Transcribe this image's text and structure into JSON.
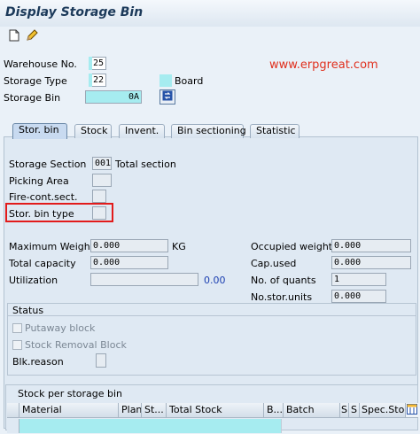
{
  "window": {
    "title": "Display Storage Bin"
  },
  "toolbar": {
    "buttons": [
      {
        "icon": "new-document-icon"
      },
      {
        "icon": "pencil-icon"
      }
    ]
  },
  "watermark": "www.erpgreat.com",
  "header": {
    "warehouse_label": "Warehouse No.",
    "warehouse_value": "25",
    "storage_type_label": "Storage Type",
    "storage_type_value": "22",
    "storage_type_desc": "Board",
    "storage_bin_label": "Storage Bin",
    "storage_bin_value": "0A"
  },
  "tabs": [
    {
      "label": "Stor. bin",
      "active": true
    },
    {
      "label": "Stock",
      "active": false
    },
    {
      "label": "Invent.",
      "active": false
    },
    {
      "label": "Bin sectioning",
      "active": false
    },
    {
      "label": "Statistic",
      "active": false
    }
  ],
  "stor_bin": {
    "storage_section_label": "Storage Section",
    "storage_section_value": "001",
    "storage_section_desc": "Total section",
    "picking_area_label": "Picking Area",
    "fire_cont_label": "Fire-cont.sect.",
    "stor_bin_type_label": "Stor. bin type",
    "max_weight_label": "Maximum Weight",
    "max_weight_value": "0.000",
    "max_weight_unit": "KG",
    "total_capacity_label": "Total capacity",
    "total_capacity_value": "0.000",
    "utilization_label": "Utilization",
    "utilization_value": "0.00",
    "occupied_weight_label": "Occupied weight",
    "occupied_weight_value": "0.000",
    "cap_used_label": "Cap.used",
    "cap_used_value": "0.000",
    "num_quants_label": "No. of quants",
    "num_quants_value": "1",
    "num_stor_units_label": "No.stor.units",
    "num_stor_units_value": "0.000"
  },
  "status": {
    "title": "Status",
    "putaway_block_label": "Putaway block",
    "putaway_block_checked": false,
    "stock_removal_block_label": "Stock Removal Block",
    "stock_removal_block_checked": false,
    "blk_reason_label": "Blk.reason"
  },
  "stock_grid": {
    "title": "Stock per storage bin",
    "columns": [
      "Material",
      "Plant",
      "St...",
      "Total Stock",
      "B...",
      "Batch",
      "S",
      "S",
      "Spec.Stock"
    ]
  },
  "colors": {
    "highlight_box": "#e21b1b",
    "watermark": "#e0301e",
    "input_cyan": "#a6ecf0"
  }
}
